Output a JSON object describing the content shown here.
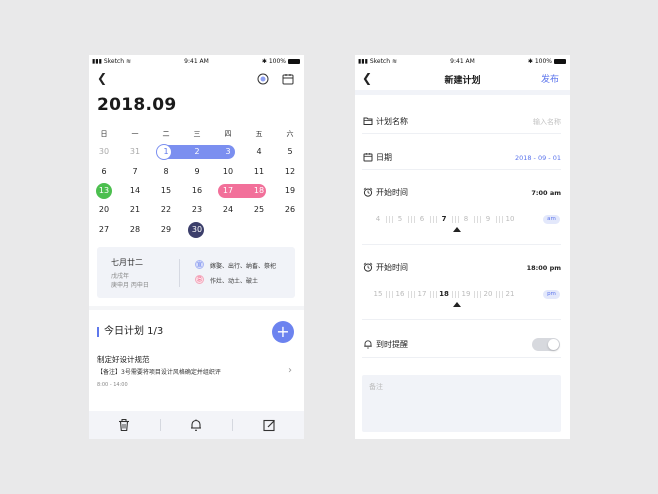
{
  "colors": {
    "accent": "#5e78ec",
    "range_blue": "#7b8ff0",
    "range_pink": "#f2709a",
    "today_green": "#4cbf4f",
    "selected_navy": "#3c3f6b"
  },
  "status_bar": {
    "carrier": "Sketch",
    "time": "9:41 AM",
    "battery": "100%"
  },
  "calendar": {
    "month_title": "2018.09",
    "weekdays": [
      "日",
      "一",
      "二",
      "三",
      "四",
      "五",
      "六"
    ],
    "weeks": [
      [
        "30",
        "31",
        "1",
        "2",
        "3",
        "4",
        "5"
      ],
      [
        "6",
        "7",
        "8",
        "9",
        "10",
        "11",
        "12"
      ],
      [
        "13",
        "14",
        "15",
        "16",
        "17",
        "18",
        "19"
      ],
      [
        "20",
        "21",
        "22",
        "23",
        "24",
        "25",
        "26"
      ],
      [
        "27",
        "28",
        "29",
        "30",
        "",
        "",
        ""
      ]
    ]
  },
  "lunar": {
    "date": "七月廿二",
    "year": "戊戌年",
    "month_day": "庚申月 丙申日",
    "good_badge": "宜",
    "good_text": "嫁娶、出行、纳畜、祭祀",
    "bad_badge": "忌",
    "bad_text": "作灶、动土、破土"
  },
  "plan": {
    "title": "今日计划 1/3",
    "add_label": "+",
    "task_title": "制定好设计规范",
    "task_note": "【备注】3号需要将项目设计风格确定并组织评",
    "task_time": "8:00 - 14:00",
    "chevron": "›"
  },
  "new_plan": {
    "nav_title": "新建计划",
    "publish_label": "发布",
    "name_label": "计划名称",
    "name_placeholder": "输入名称",
    "date_label": "日期",
    "date_value": "2018 - 09 - 01",
    "start_label_1": "开始时间",
    "start_value_1": "7:00  am",
    "ruler_1": [
      "4",
      "5",
      "6",
      "7",
      "8",
      "9",
      "10"
    ],
    "ampm_1": "am",
    "start_label_2": "开始时间",
    "start_value_2": "18:00  pm",
    "ruler_2": [
      "15",
      "16",
      "17",
      "18",
      "19",
      "20",
      "21"
    ],
    "ampm_2": "pm",
    "reminder_label": "到时提醒",
    "note_placeholder": "备注"
  }
}
